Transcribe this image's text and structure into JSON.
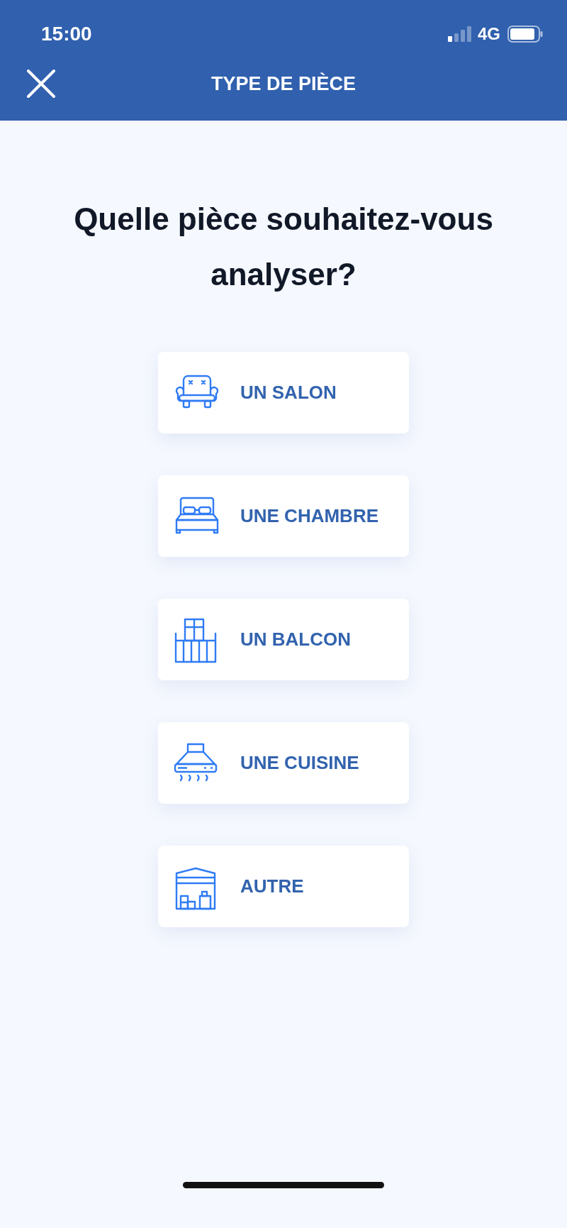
{
  "status_bar": {
    "time": "15:00",
    "network": "4G"
  },
  "header": {
    "title": "TYPE DE PIÈCE"
  },
  "question": "Quelle pièce souhaitez-vous analyser?",
  "options": [
    {
      "label": "UN SALON",
      "kind": "armchair"
    },
    {
      "label": "UNE CHAMBRE",
      "kind": "bed"
    },
    {
      "label": "UN BALCON",
      "kind": "balcony"
    },
    {
      "label": "UNE CUISINE",
      "kind": "hood"
    },
    {
      "label": "AUTRE",
      "kind": "storage"
    }
  ]
}
